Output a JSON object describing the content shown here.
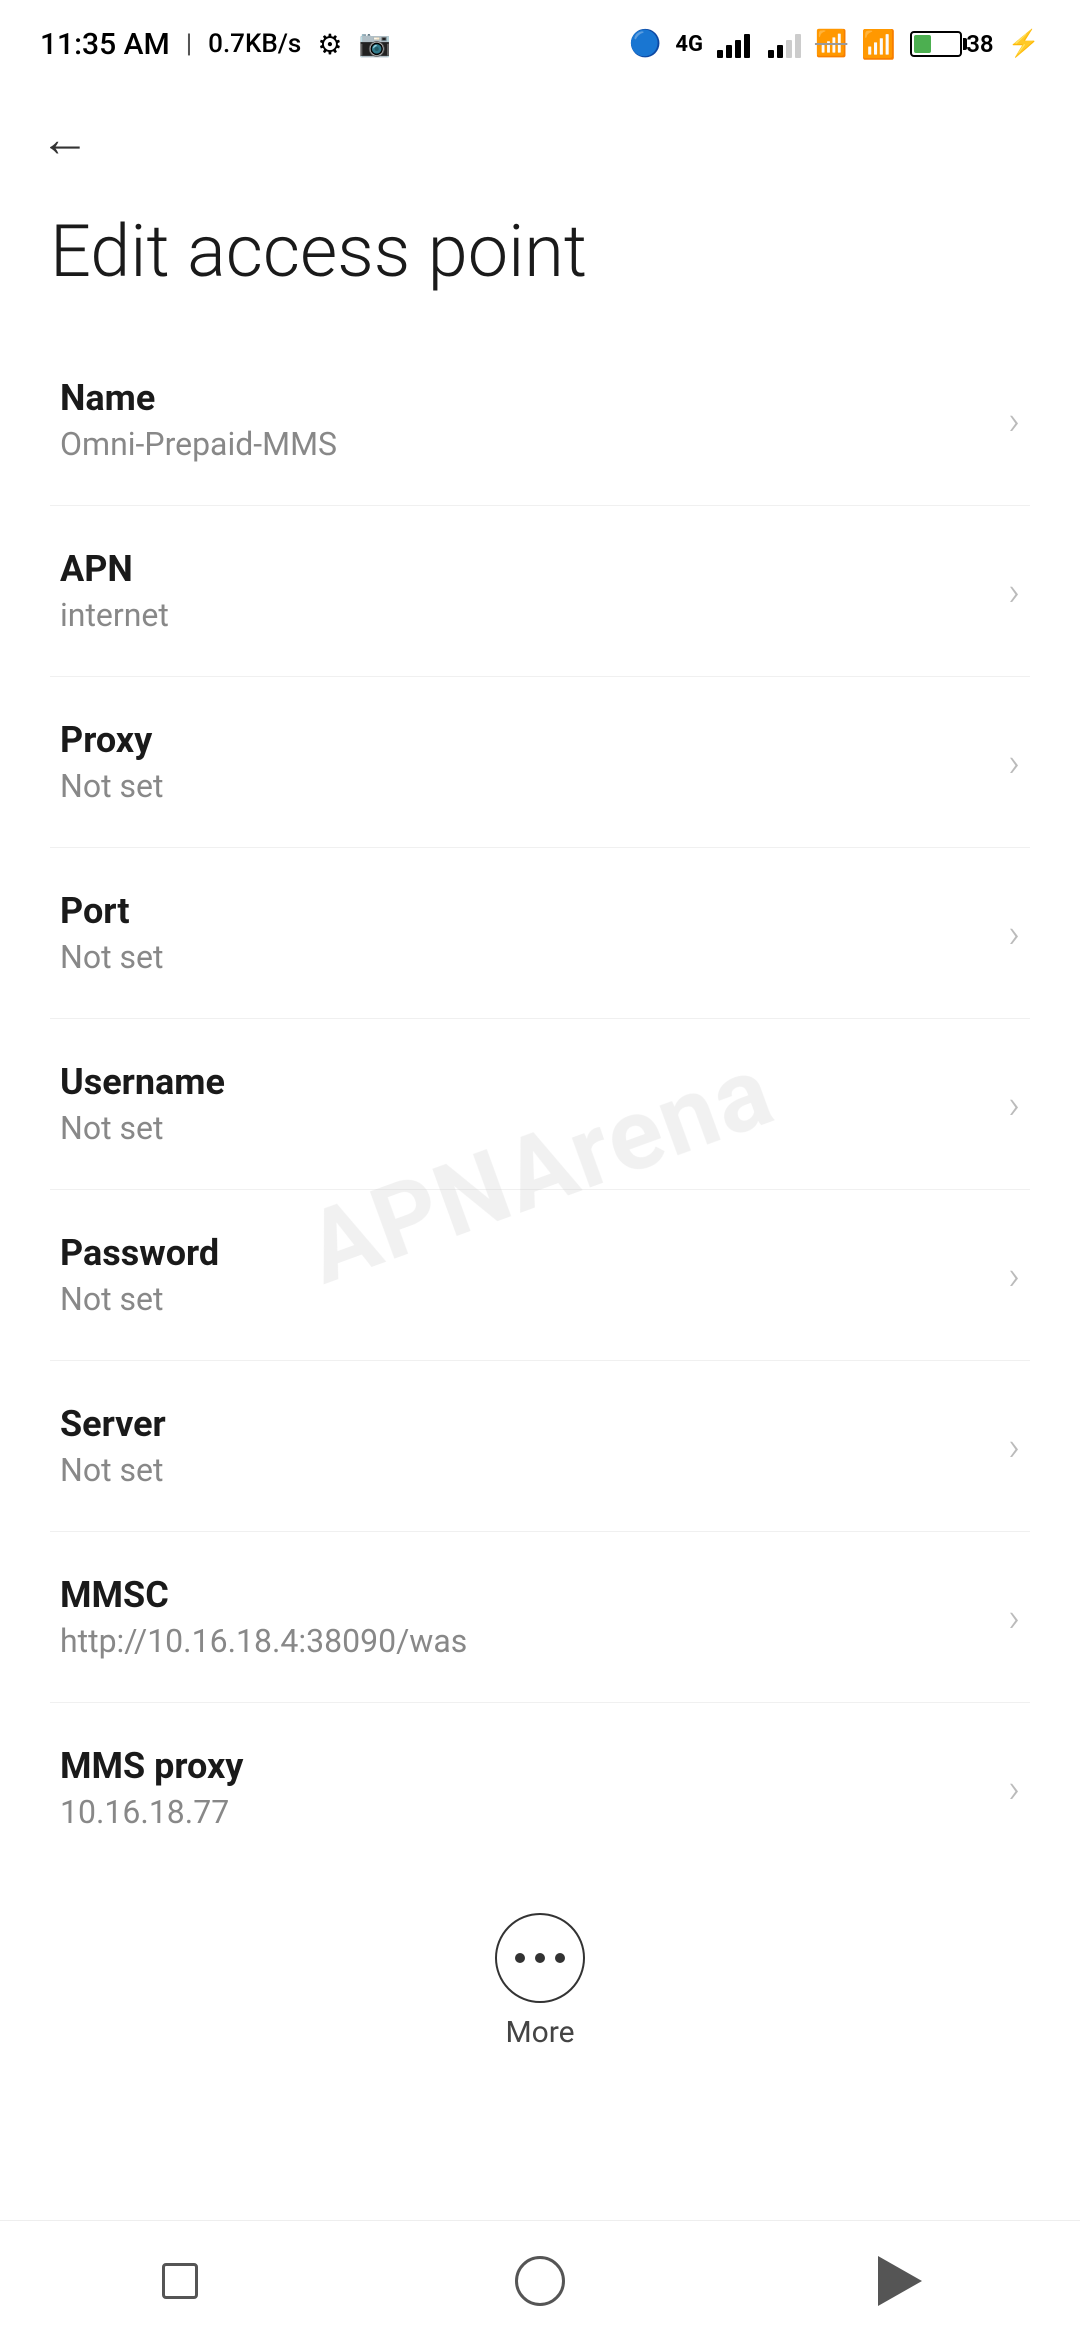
{
  "statusBar": {
    "time": "11:35 AM",
    "speed": "0.7KB/s"
  },
  "nav": {
    "backLabel": "←"
  },
  "page": {
    "title": "Edit access point"
  },
  "settings": [
    {
      "id": "name",
      "title": "Name",
      "value": "Omni-Prepaid-MMS"
    },
    {
      "id": "apn",
      "title": "APN",
      "value": "internet"
    },
    {
      "id": "proxy",
      "title": "Proxy",
      "value": "Not set"
    },
    {
      "id": "port",
      "title": "Port",
      "value": "Not set"
    },
    {
      "id": "username",
      "title": "Username",
      "value": "Not set"
    },
    {
      "id": "password",
      "title": "Password",
      "value": "Not set"
    },
    {
      "id": "server",
      "title": "Server",
      "value": "Not set"
    },
    {
      "id": "mmsc",
      "title": "MMSC",
      "value": "http://10.16.18.4:38090/was"
    },
    {
      "id": "mms-proxy",
      "title": "MMS proxy",
      "value": "10.16.18.77"
    }
  ],
  "more": {
    "label": "More"
  },
  "watermark": "APNArena"
}
